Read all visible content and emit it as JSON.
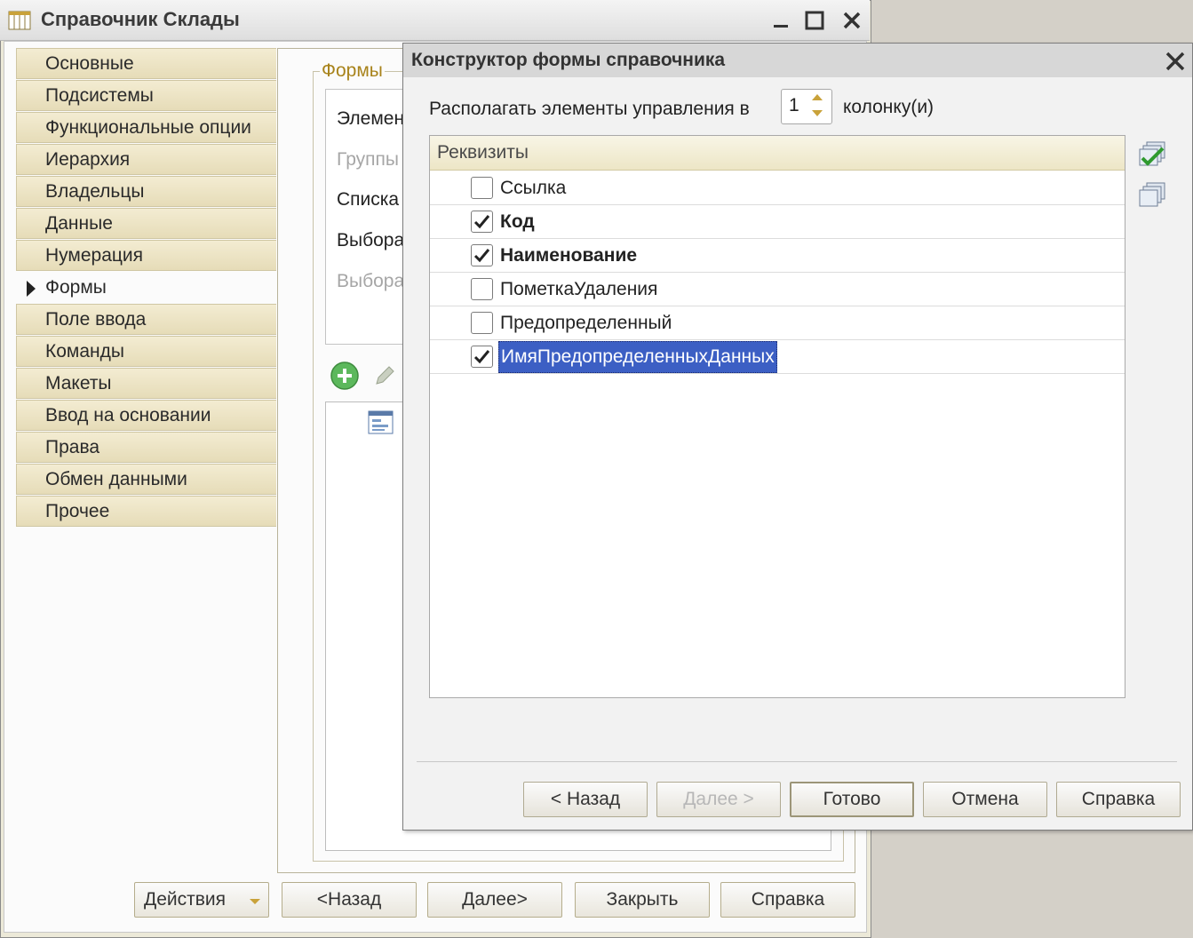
{
  "main_window": {
    "title": "Справочник Склады",
    "nav_items": [
      {
        "label": "Основные"
      },
      {
        "label": "Подсистемы"
      },
      {
        "label": "Функциональные опции"
      },
      {
        "label": "Иерархия"
      },
      {
        "label": "Владельцы"
      },
      {
        "label": "Данные"
      },
      {
        "label": "Нумерация"
      },
      {
        "label": "Формы",
        "active": true
      },
      {
        "label": "Поле ввода"
      },
      {
        "label": "Команды"
      },
      {
        "label": "Макеты"
      },
      {
        "label": "Ввод на основании"
      },
      {
        "label": "Права"
      },
      {
        "label": "Обмен данными"
      },
      {
        "label": "Прочее"
      }
    ],
    "forms_group": {
      "legend": "Формы",
      "rows": [
        "Элемен",
        "Группы",
        "Списка",
        "Выбора",
        "Выбора"
      ]
    },
    "bottom_buttons": {
      "actions": "Действия",
      "back": "<Назад",
      "next": "Далее>",
      "close": "Закрыть",
      "help": "Справка"
    }
  },
  "dialog": {
    "title": "Конструктор формы справочника",
    "columns_label": "Располагать элементы управления в",
    "columns_value": "1",
    "columns_suffix": "колонку(и)",
    "table_header": "Реквизиты",
    "rows": [
      {
        "label": "Ссылка",
        "checked": false
      },
      {
        "label": "Код",
        "checked": true
      },
      {
        "label": "Наименование",
        "checked": true
      },
      {
        "label": "ПометкаУдаления",
        "checked": false
      },
      {
        "label": "Предопределенный",
        "checked": false
      },
      {
        "label": "ИмяПредопределенныхДанных",
        "checked": true,
        "selected": true
      }
    ],
    "buttons": {
      "back": "< Назад",
      "next": "Далее >",
      "done": "Готово",
      "cancel": "Отмена",
      "help": "Справка"
    }
  },
  "colors": {
    "accent_gold": "#a8831b",
    "selection_blue": "#3c5fc4",
    "nav_background": "#e6dcb8"
  }
}
